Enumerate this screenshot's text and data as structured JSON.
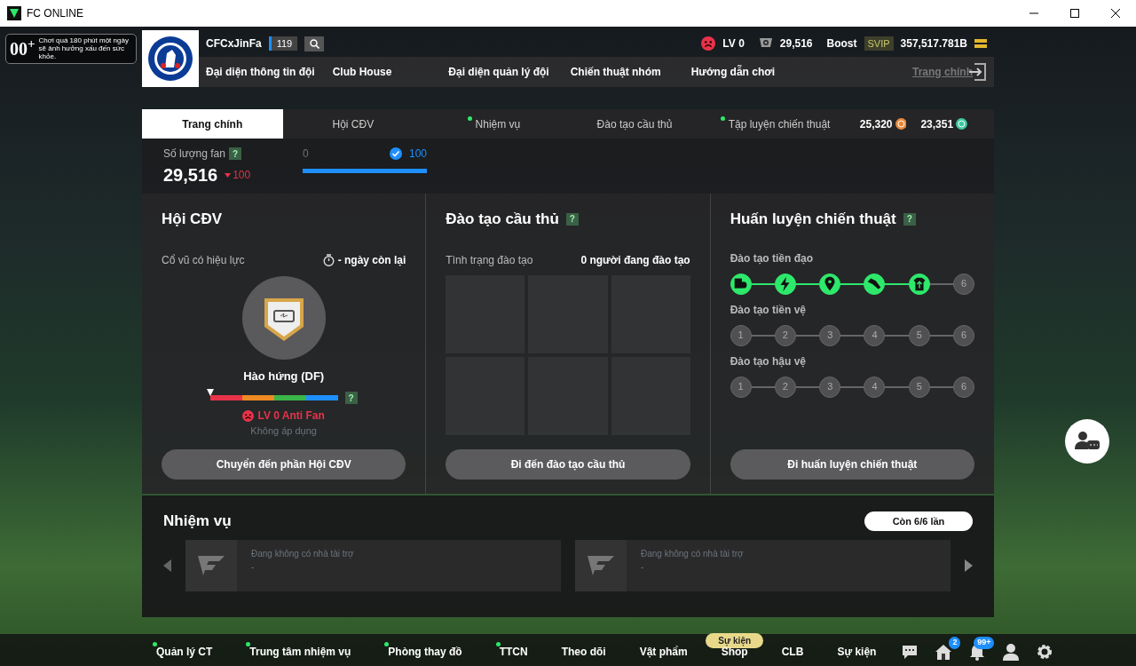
{
  "window": {
    "title": "FC ONLINE"
  },
  "age_notice": {
    "rating": "00$^{+}$",
    "text": "Chơi quá 180 phút một ngày sẽ ảnh hưởng xấu đến sức khỏe."
  },
  "club": {
    "name": "CFCxJinFa",
    "level": "119"
  },
  "nav": [
    "Đại diện thông tin đội",
    "Club House",
    "Đại diện quản lý đội",
    "Chiến thuật nhóm",
    "Hướng dẫn chơi"
  ],
  "home_link": "Trang chính",
  "stats": {
    "level": "LV 0",
    "fans": "29,516",
    "boost": "Boost",
    "vip": "SVIP",
    "coins": "357,517.781B"
  },
  "tabs": [
    {
      "label": "Trang chính",
      "selected": true,
      "dot": false
    },
    {
      "label": "Hội CĐV",
      "selected": false,
      "dot": false
    },
    {
      "label": "Nhiệm vụ",
      "selected": false,
      "dot": true
    },
    {
      "label": "Đào tạo cầu thủ",
      "selected": false,
      "dot": false
    },
    {
      "label": "Tập luyện chiến thuật",
      "selected": false,
      "dot": true
    }
  ],
  "currencies": [
    {
      "kind": "sc",
      "amount": "25,320"
    },
    {
      "kind": "tc",
      "amount": "23,351"
    }
  ],
  "fan_count": {
    "label": "Số lượng fan",
    "help": "?",
    "value": "29,516",
    "change": "100",
    "progress": {
      "start": "0",
      "end": "100",
      "level": 1
    }
  },
  "supporters": {
    "title": "Hội CĐV",
    "cheer_label": "Cổ vũ có hiệu lực",
    "days_left": "- ngày còn lại",
    "mood": "Hào hứng (DF)",
    "mood_meter": {
      "level": 0
    },
    "help": "?",
    "rank": "LV 0 Anti Fan",
    "note": "Không áp dụng",
    "button": "Chuyển đến phần Hội CĐV"
  },
  "player_training": {
    "title": "Đào tạo cầu thủ",
    "help": "?",
    "status_label": "Tình trạng đào tạo",
    "status_value": "0 người đang đào tạo",
    "button": "Đi đến đào tạo cầu thủ"
  },
  "tactical_training": {
    "title": "Huấn luyện chiến thuật",
    "help": "?",
    "button": "Đi huấn luyện chiến thuật",
    "tracks": [
      {
        "label": "Đào tạo tiền đạo",
        "nodes": [
          {
            "completed": true
          },
          {
            "completed": true
          },
          {
            "completed": true
          },
          {
            "completed": true
          },
          {
            "completed": true
          },
          {
            "label": "6",
            "completed": false
          }
        ]
      },
      {
        "label": "Đào tạo tiền vệ",
        "nodes": [
          {
            "label": "1",
            "completed": false
          },
          {
            "label": "2",
            "completed": false
          },
          {
            "label": "3",
            "completed": false
          },
          {
            "label": "4",
            "completed": false
          },
          {
            "label": "5",
            "completed": false
          },
          {
            "label": "6",
            "completed": false
          }
        ]
      },
      {
        "label": "Đào tạo hậu vệ",
        "nodes": [
          {
            "label": "1",
            "completed": false
          },
          {
            "label": "2",
            "completed": false
          },
          {
            "label": "3",
            "completed": false
          },
          {
            "label": "4",
            "completed": false
          },
          {
            "label": "5",
            "completed": false
          },
          {
            "label": "6",
            "completed": false
          }
        ]
      }
    ]
  },
  "missions": {
    "title": "Nhiệm vụ",
    "remaining": "Còn 6/6 lần",
    "cards": [
      {
        "text": "Đang không có nhà tài trợ",
        "detail": "-"
      },
      {
        "text": "Đang không có nhà tài trợ",
        "detail": "-"
      }
    ]
  },
  "bottom_bar": {
    "items": [
      {
        "label": "Quản lý CT",
        "dot": true
      },
      {
        "label": "Trung tâm nhiệm vụ",
        "dot": true
      },
      {
        "label": "Phòng thay đồ",
        "dot": true
      },
      {
        "label": "TTCN",
        "dot": true
      },
      {
        "label": "Theo dõi",
        "dot": false
      },
      {
        "label": "Vật phẩm",
        "dot": false
      },
      {
        "label": "Shop",
        "dot": false,
        "tag": "Sự kiện"
      },
      {
        "label": "CLB",
        "dot": false
      },
      {
        "label": "Sự kiện",
        "dot": false
      }
    ],
    "icons": [
      {
        "kind": "chat"
      },
      {
        "kind": "home",
        "badge": "2"
      },
      {
        "kind": "bell",
        "badge": "99+"
      },
      {
        "kind": "profile"
      },
      {
        "kind": "settings"
      }
    ]
  }
}
